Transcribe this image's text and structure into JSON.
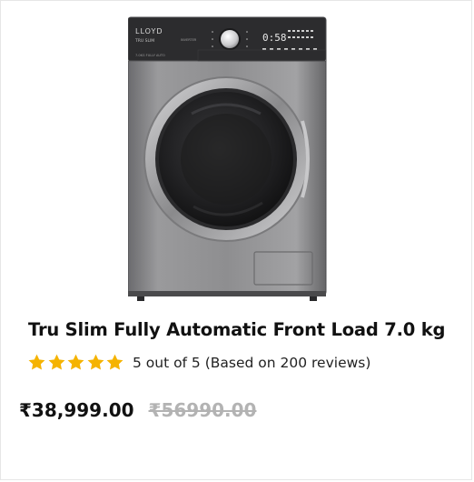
{
  "product": {
    "image_icon": "front-load-washing-machine",
    "brand_logo": "LLOYD",
    "brand_sub": "TRU SLIM",
    "display_reading": "0:58",
    "title": "Tru Slim Fully Automatic Front Load 7.0 kg",
    "rating": {
      "stars_filled": 5,
      "stars_total": 5,
      "star_color": "#f5b301",
      "text": "5 out of 5 (Based on 200 reviews)"
    },
    "price": {
      "current": "₹38,999.00",
      "original": "₹56990.00"
    }
  },
  "colors": {
    "accent_star": "#f5b301",
    "text_primary": "#111111",
    "text_strikethrough": "#b3b3b3"
  }
}
